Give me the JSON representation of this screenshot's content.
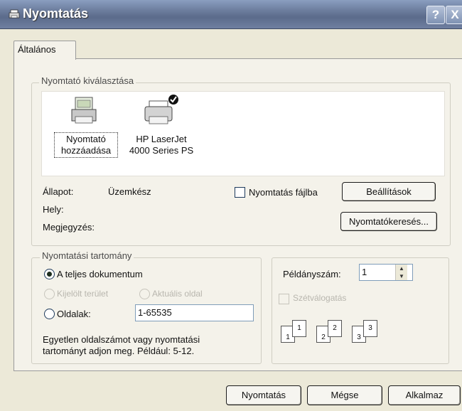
{
  "window": {
    "title": "Nyomtatás",
    "help_label": "?",
    "close_label": "X"
  },
  "tabs": [
    {
      "label": "Általános"
    }
  ],
  "printer_select": {
    "legend": "Nyomtató kiválasztása",
    "printers": [
      {
        "line1": "Nyomtató",
        "line2": "hozzáadása",
        "icon": "add-printer-icon"
      },
      {
        "line1": "HP LaserJet",
        "line2": "4000 Series PS",
        "icon": "default-printer-icon"
      }
    ],
    "status_label": "Állapot:",
    "status_value": "Üzemkész",
    "location_label": "Hely:",
    "comment_label": "Megjegyzés:",
    "print_to_file_label": "Nyomtatás fájlba",
    "settings_button": "Beállítások",
    "find_printer_button": "Nyomtatókeresés..."
  },
  "page_range": {
    "legend": "Nyomtatási tartomány",
    "all_label": "A teljes dokumentum",
    "selection_label": "Kijelölt terület",
    "current_page_label": "Aktuális oldal",
    "pages_label": "Oldalak:",
    "pages_value": "1-65535",
    "hint_line1": "Egyetlen oldalszámot vagy nyomtatási",
    "hint_line2": "tartományt adjon meg. Például: 5-12."
  },
  "copies": {
    "label": "Példányszám:",
    "value": "1",
    "collate_label": "Szétválogatás",
    "collate_pages": [
      "1",
      "1",
      "2",
      "2",
      "3",
      "3"
    ]
  },
  "footer": {
    "print_button": "Nyomtatás",
    "cancel_button": "Mégse",
    "apply_button": "Alkalmaz"
  }
}
